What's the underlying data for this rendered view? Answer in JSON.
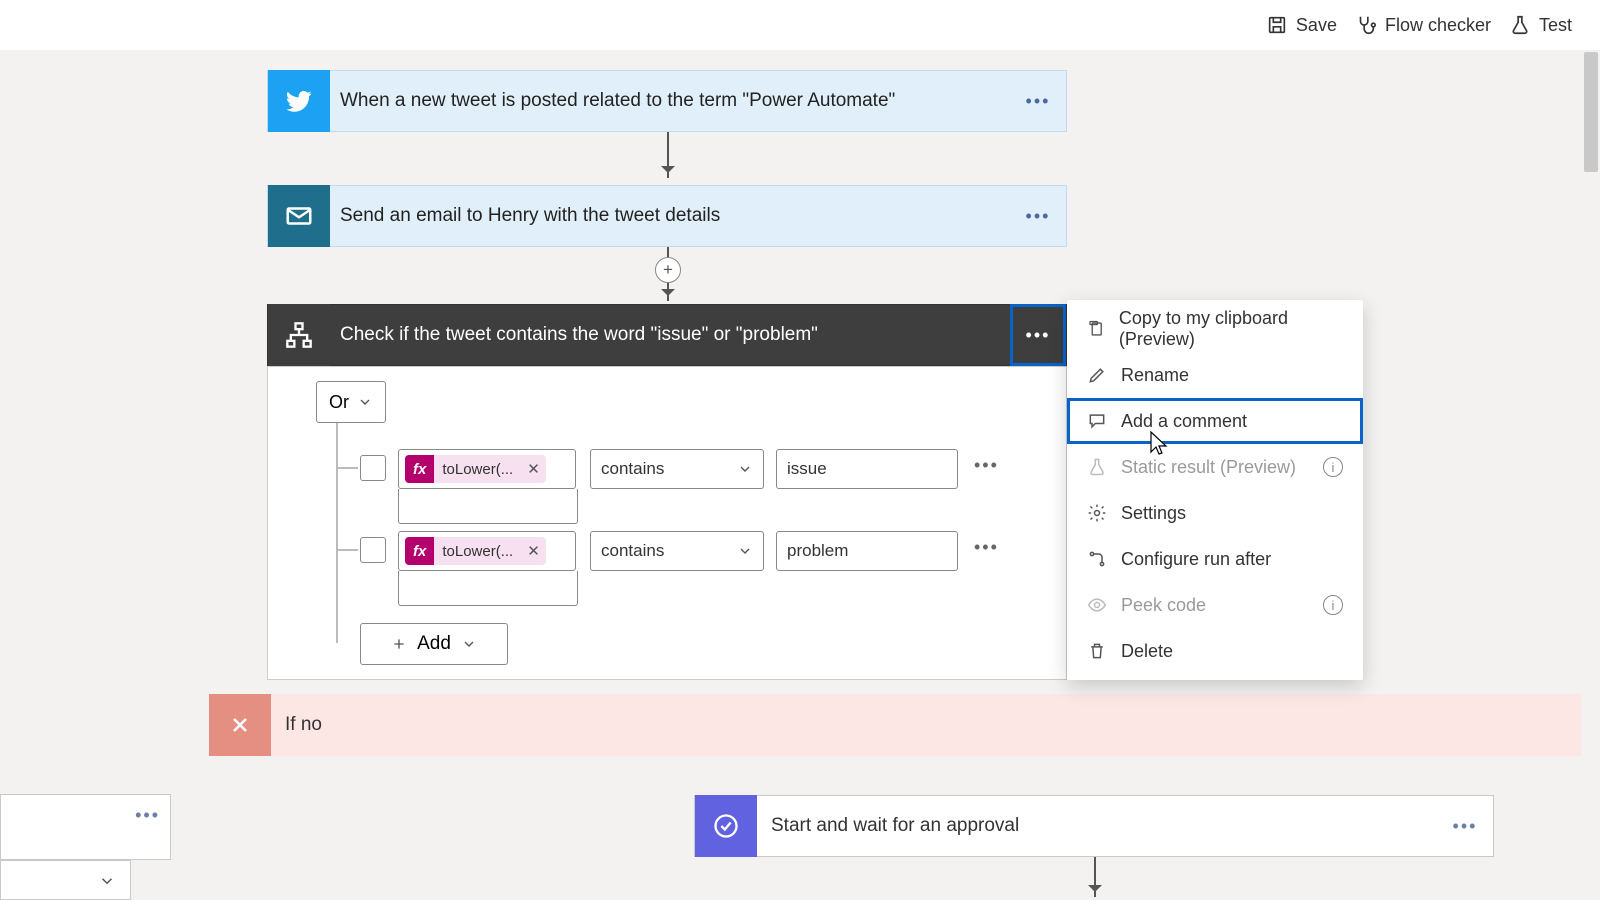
{
  "toolbar": {
    "save": "Save",
    "flow_checker": "Flow checker",
    "test": "Test"
  },
  "trigger": {
    "title": "When a new tweet is posted related to the term \"Power Automate\""
  },
  "email": {
    "title": "Send an email to Henry with the tweet details"
  },
  "condition": {
    "title": "Check if the tweet contains the word \"issue\" or \"problem\"",
    "group": "Or",
    "rows": [
      {
        "token": "toLower(...",
        "op": "contains",
        "value": "issue"
      },
      {
        "token": "toLower(...",
        "op": "contains",
        "value": "problem"
      }
    ],
    "add": "Add"
  },
  "ifno": {
    "title": "If no"
  },
  "approval": {
    "title": "Start and wait for an approval"
  },
  "menu": {
    "copy": "Copy to my clipboard (Preview)",
    "rename": "Rename",
    "comment": "Add a comment",
    "static": "Static result (Preview)",
    "settings": "Settings",
    "runafter": "Configure run after",
    "peek": "Peek code",
    "delete": "Delete"
  },
  "fx_label": "fx"
}
